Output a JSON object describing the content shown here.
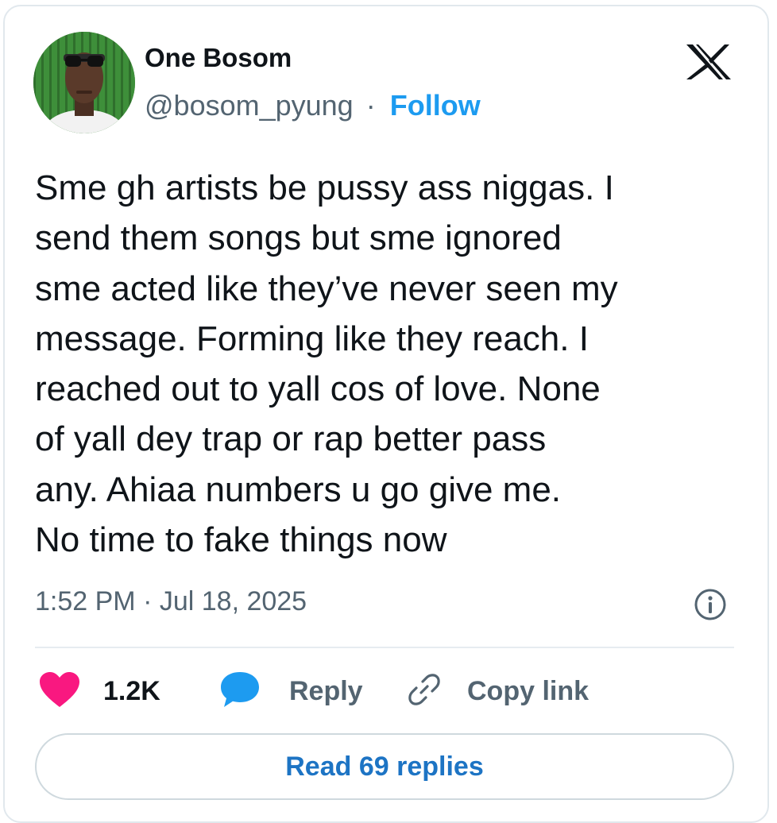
{
  "author": {
    "name": "One Bosom",
    "handle": "@bosom_pyung",
    "separator": "·",
    "follow_label": "Follow"
  },
  "tweet": {
    "text": "Sme gh artists be pussy ass niggas. I\nsend them songs but sme ignored\nsme acted like they’ve never seen my\nmessage. Forming like they reach. I\nreached out to yall cos of love. None\nof yall dey trap or rap better pass\nany. Ahiaa numbers u go give me.\nNo time to fake things now",
    "timestamp": "1:52 PM · Jul 18, 2025"
  },
  "actions": {
    "like_count": "1.2K",
    "reply_label": "Reply",
    "copy_link_label": "Copy link"
  },
  "read_replies_label": "Read 69 replies",
  "icons": {
    "logo": "x-logo-icon",
    "info": "info-icon",
    "like": "heart-icon",
    "reply": "speech-bubble-icon",
    "copy_link": "link-icon"
  },
  "colors": {
    "accent": "#1d9bf0",
    "like": "#f91880",
    "text": "#0f1419",
    "muted": "#536471",
    "border": "#cfd9de"
  }
}
